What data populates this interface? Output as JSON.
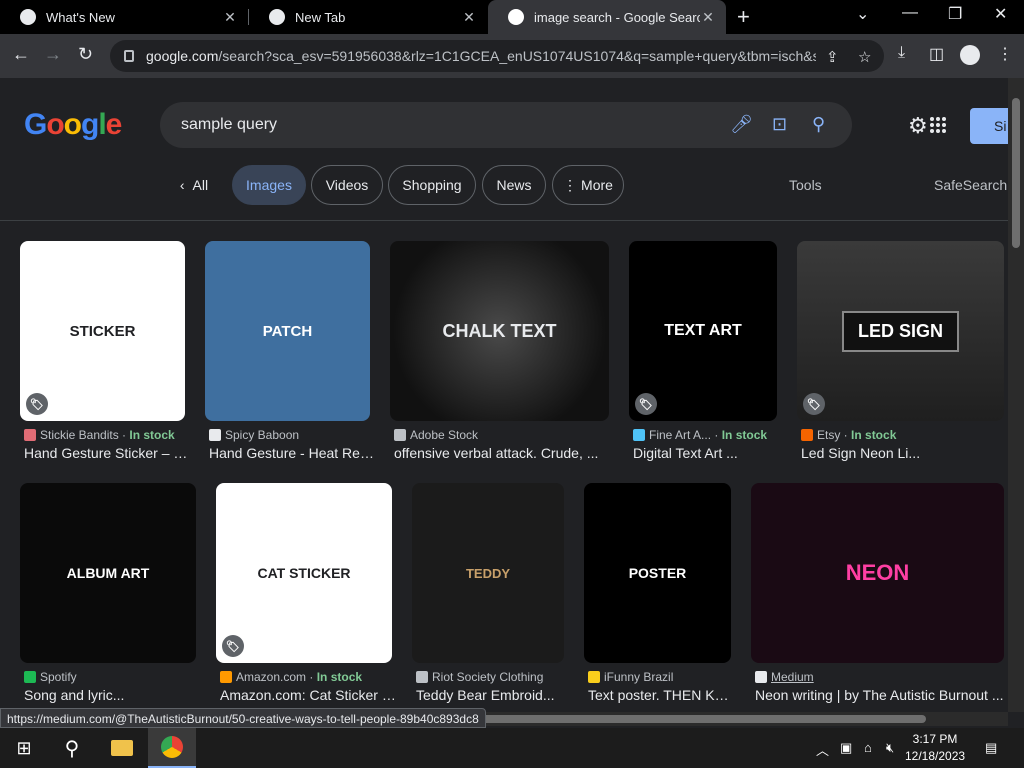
{
  "tabs": [
    {
      "title": "What's New",
      "close": "✕"
    },
    {
      "title": "New Tab",
      "close": "✕"
    },
    {
      "title": "image search - Google Search",
      "close": "✕"
    }
  ],
  "new_tab": "+",
  "window_controls": {
    "dropdown": "⌄",
    "minimize": "—",
    "restore": "❐",
    "close": "✕"
  },
  "toolbar": {
    "back": "←",
    "forward": "→",
    "reload": "↻",
    "url_host": "google.com",
    "url_path": "/search?sca_esv=591956038&rlz=1C1GCEA_enUS1074US1074&q=sample+query&tbm=isch&source..."
  },
  "google": {
    "logo_letters": [
      "G",
      "o",
      "o",
      "g",
      "l",
      "e"
    ],
    "logo_colors": [
      "#4285f4",
      "#ea4335",
      "#fbbc05",
      "#4285f4",
      "#34a853",
      "#ea4335"
    ],
    "query": "sample query",
    "signin": "Si"
  },
  "filters": {
    "all": "All",
    "items": [
      "Images",
      "Videos",
      "Shopping",
      "News",
      "More"
    ],
    "tools": "Tools",
    "safesearch": "SafeSearch"
  },
  "results": [
    {
      "source": "Stickie Bandits",
      "in_stock": "In stock",
      "caption": "Hand Gesture Sticker – Stic...",
      "thumb_text": "STICKER",
      "fav_color": "#e06c75"
    },
    {
      "source": "Spicy Baboon",
      "in_stock": "",
      "caption": "Hand Gesture - Heat Reve...",
      "thumb_text": "PATCH",
      "fav_color": "#e8eaed"
    },
    {
      "source": "Adobe Stock",
      "in_stock": "",
      "caption": "offensive verbal attack. Crude, ...",
      "thumb_text": "CHALK TEXT",
      "fav_color": "#bdc1c6"
    },
    {
      "source": "Fine Art A...",
      "in_stock": "In stock",
      "caption": "Digital Text Art ...",
      "thumb_text": "TEXT ART",
      "fav_color": "#4fc3f7"
    },
    {
      "source": "Etsy",
      "in_stock": "In stock",
      "caption": "Led Sign Neon Li...",
      "thumb_text": "LED SIGN",
      "fav_color": "#f56400"
    },
    {
      "source": "Spotify",
      "in_stock": "",
      "caption": "Song and lyric...",
      "thumb_text": "ALBUM ART",
      "fav_color": "#1db954"
    },
    {
      "source": "Amazon.com",
      "in_stock": "In stock",
      "caption": "Amazon.com: Cat Sticker S...",
      "thumb_text": "CAT STICKER",
      "fav_color": "#ff9900"
    },
    {
      "source": "Riot Society Clothing",
      "in_stock": "",
      "caption": "Teddy Bear Embroid...",
      "thumb_text": "TEDDY",
      "fav_color": "#bdc1c6"
    },
    {
      "source": "iFunny Brazil",
      "in_stock": "",
      "caption": "Text poster. THEN KE...",
      "thumb_text": "POSTER",
      "fav_color": "#f9ce1c"
    },
    {
      "source": "Medium",
      "in_stock": "",
      "caption": "Neon writing | by The Autistic Burnout ...",
      "thumb_text": "NEON",
      "fav_color": "#e8eaed"
    }
  ],
  "status_url": "https://medium.com/@TheAutisticBurnout/50-creative-ways-to-tell-people-89b40c893dc8",
  "taskbar": {
    "time": "3:17 PM",
    "date": "12/18/2023"
  }
}
